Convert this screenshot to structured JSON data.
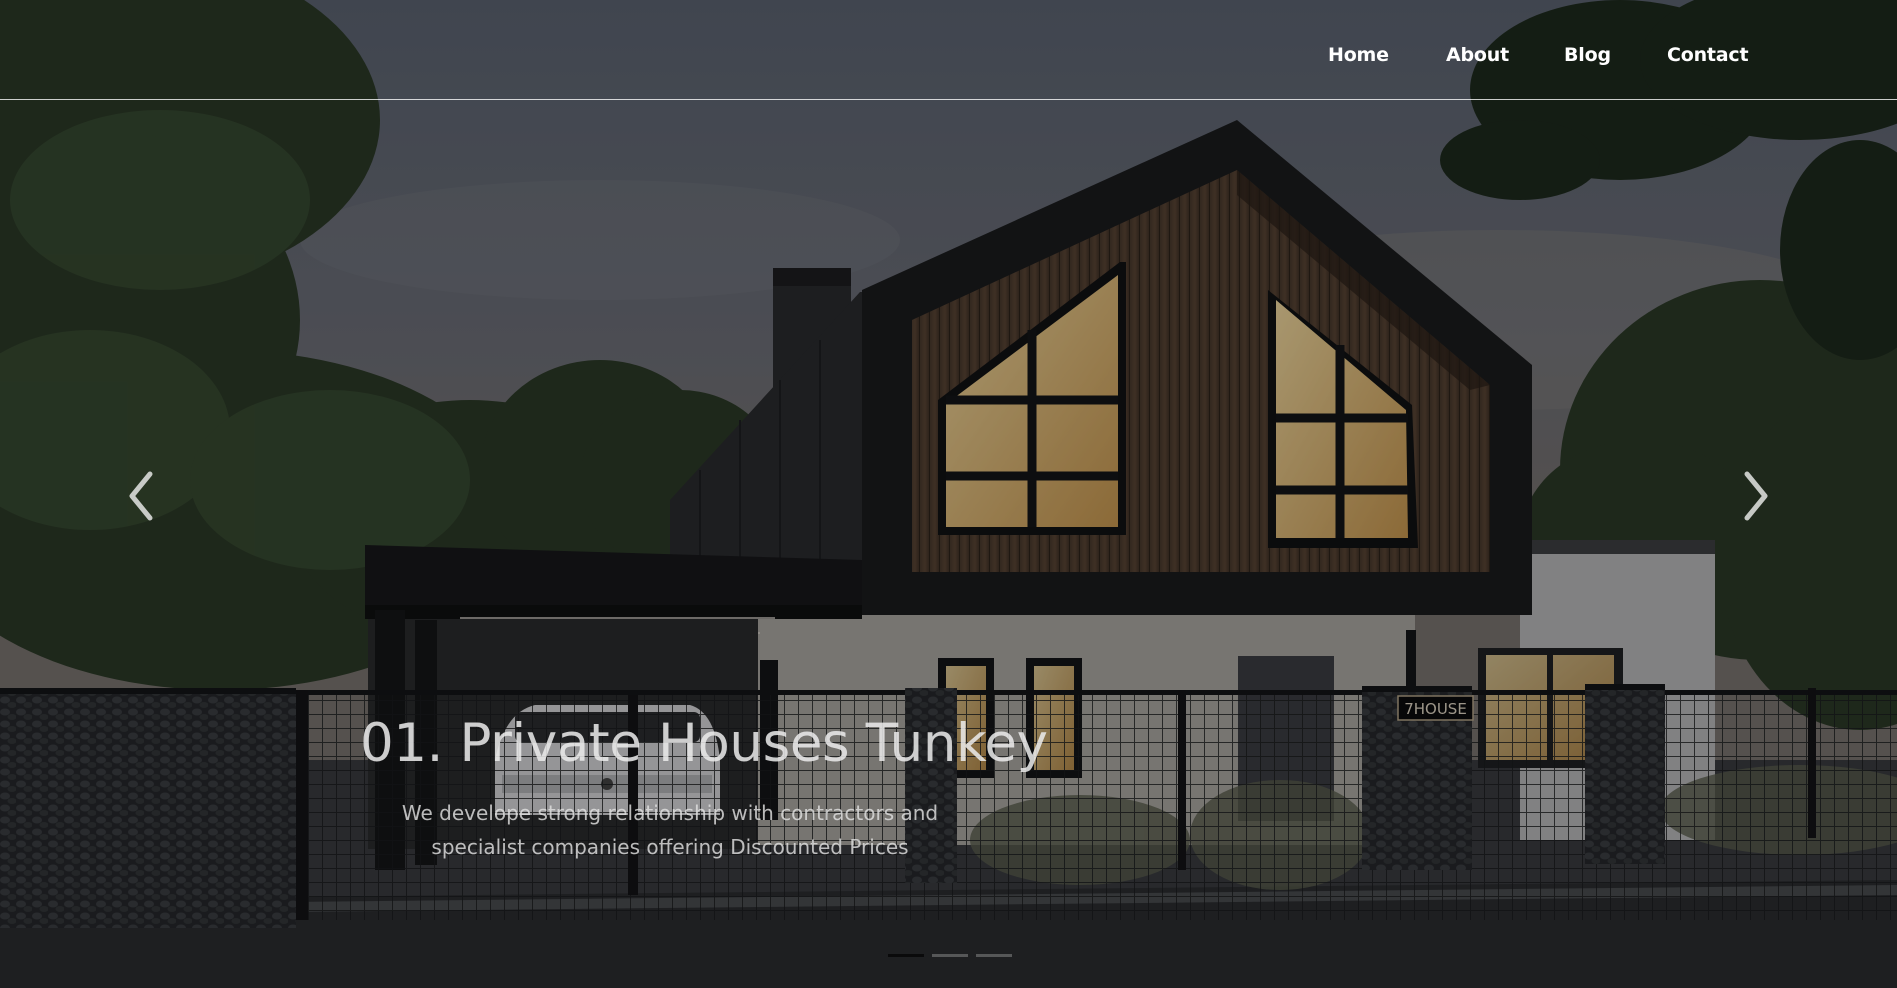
{
  "nav": {
    "items": [
      {
        "label": "Home"
      },
      {
        "label": "About"
      },
      {
        "label": "Blog"
      },
      {
        "label": "Contact"
      }
    ]
  },
  "carousel": {
    "prev_icon": "chevron-left-icon",
    "next_icon": "chevron-right-icon",
    "slide": {
      "title": "01. Private Houses Tunkey",
      "text": "We develope strong relationship with contractors and specialist companies offering Discounted Prices",
      "house_sign": "7HOUSE"
    },
    "indicator_count": 3,
    "active_indicator": 1
  },
  "colors": {
    "nav_text": "#ffffff",
    "overlay": "#000000",
    "sky": "#5a6170",
    "window_glow": "#e8c27a"
  }
}
